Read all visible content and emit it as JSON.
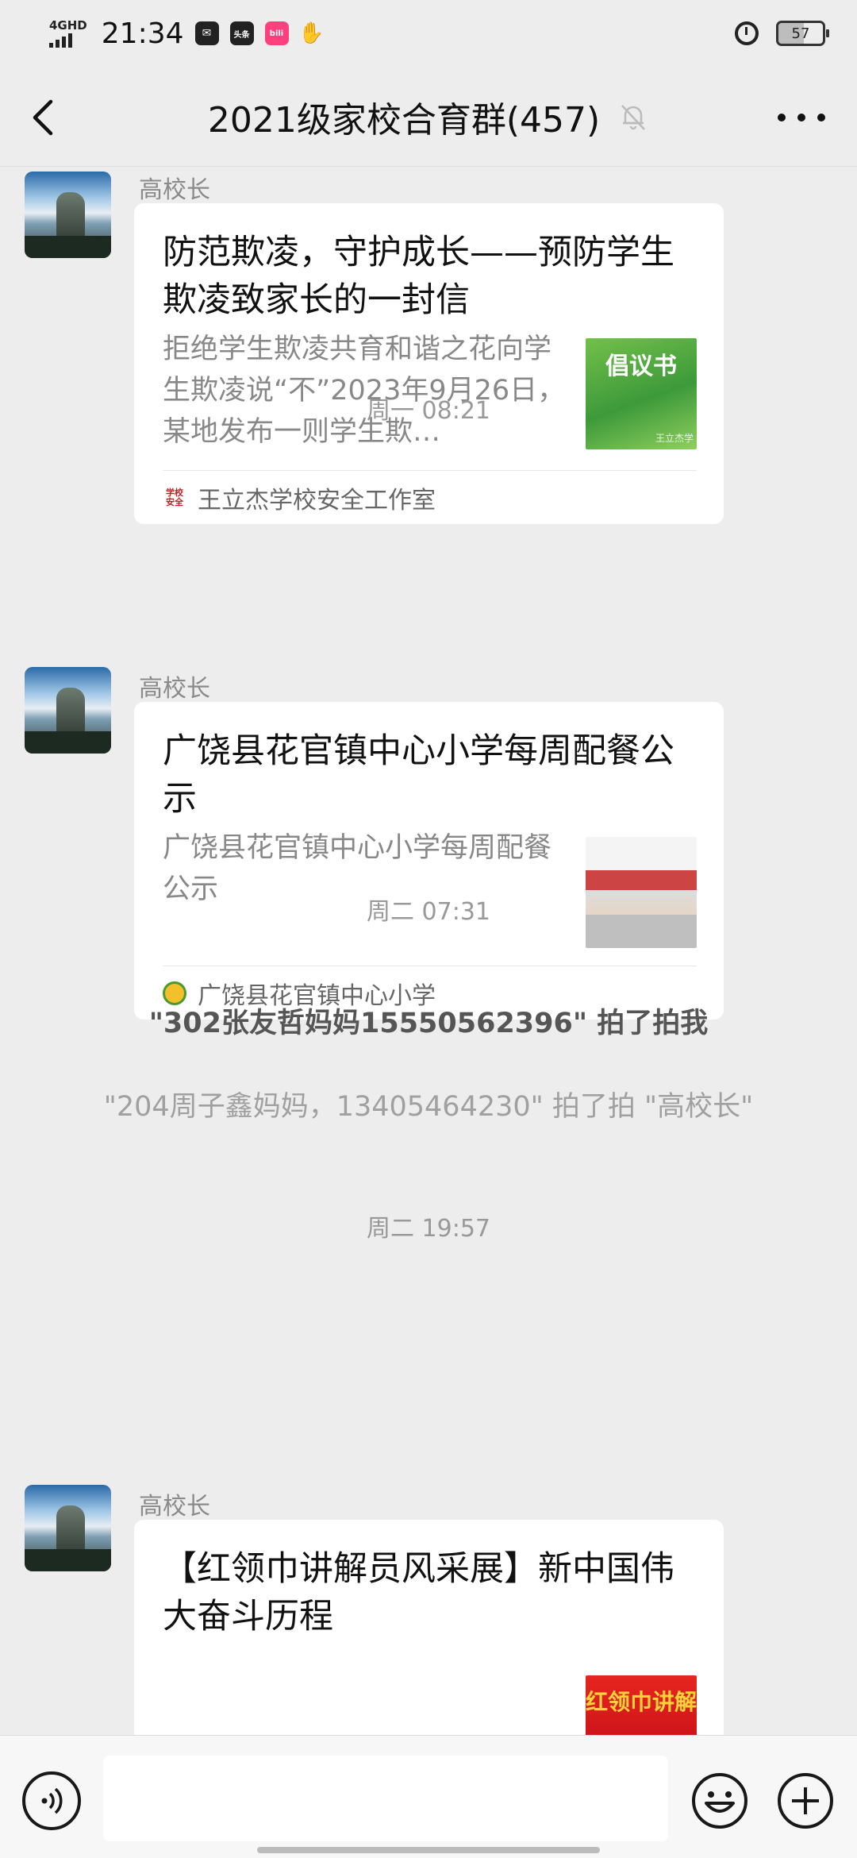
{
  "status_bar": {
    "network": "4GHD",
    "time": "21:34",
    "app_badge_toutiao": "头条",
    "app_badge_bili": "bili",
    "battery": "57"
  },
  "nav": {
    "title": "2021级家校合育群(457)"
  },
  "messages": [
    {
      "sender": "高校长",
      "title": "防范欺凌，守护成长——预防学生欺凌致家长的一封信",
      "desc": "拒绝学生欺凌共育和谐之花向学生欺凌说“不”2023年9月26日，某地发布一则学生欺…",
      "thumb_text": "倡议书",
      "thumb_caption": "王立杰学",
      "source_icon_text": "学校安全",
      "source": "王立杰学校安全工作室"
    },
    {
      "sender": "高校长",
      "title": "广饶县花官镇中心小学每周配餐公示",
      "desc": "广饶县花官镇中心小学每周配餐公示",
      "source": "广饶县花官镇中心小学"
    },
    {
      "sender": "高校长",
      "title": "【红领巾讲解员风采展】新中国伟大奋斗历程",
      "thumb_text": "红领巾讲解"
    }
  ],
  "time_separators": [
    "周一 08:21",
    "周二 07:31",
    "周二 19:57"
  ],
  "system_tips": [
    "\"302张友哲妈妈15550562396\" 拍了拍我",
    "\"204周子鑫妈妈，13405464230\" 拍了拍 \"高校长\""
  ],
  "input": {
    "placeholder": ""
  },
  "icons": {
    "back": "chevron-left-icon",
    "mute": "bell-off-icon",
    "more": "more-dots-icon",
    "voice": "voice-icon",
    "emoji": "emoji-icon",
    "plus": "plus-icon"
  }
}
